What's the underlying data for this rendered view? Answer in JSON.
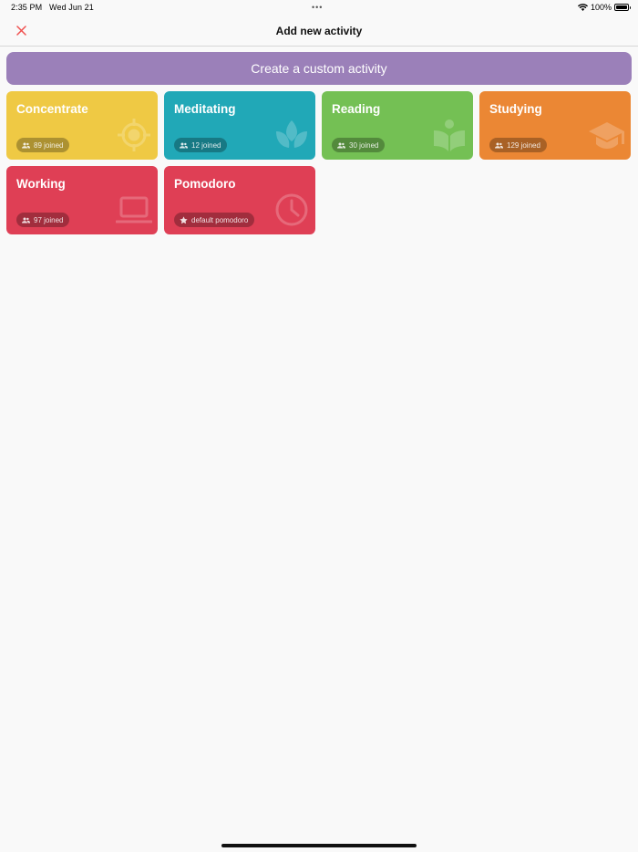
{
  "status": {
    "time": "2:35 PM",
    "date": "Wed Jun 21",
    "dots": "•••",
    "battery": "100%"
  },
  "nav": {
    "title": "Add new activity",
    "close_icon": "close-icon",
    "close_color": "#f0504f"
  },
  "custom_button": {
    "label": "Create a custom activity",
    "color": "#9b80b9"
  },
  "activities": [
    {
      "title": "Concentrate",
      "badge": "89 joined",
      "badge_icon": "people-icon",
      "icon": "target-icon",
      "color": "#efc944"
    },
    {
      "title": "Meditating",
      "badge": "12 joined",
      "badge_icon": "people-icon",
      "icon": "lotus-icon",
      "color": "#21a8b7"
    },
    {
      "title": "Reading",
      "badge": "30 joined",
      "badge_icon": "people-icon",
      "icon": "reader-icon",
      "color": "#74c054"
    },
    {
      "title": "Studying",
      "badge": "129 joined",
      "badge_icon": "people-icon",
      "icon": "graduation-cap-icon",
      "color": "#eb8734"
    },
    {
      "title": "Working",
      "badge": "97 joined",
      "badge_icon": "people-icon",
      "icon": "laptop-icon",
      "color": "#df3f55"
    },
    {
      "title": "Pomodoro",
      "badge": "default pomodoro",
      "badge_icon": "star-icon",
      "icon": "clock-icon",
      "color": "#df3f55"
    }
  ]
}
